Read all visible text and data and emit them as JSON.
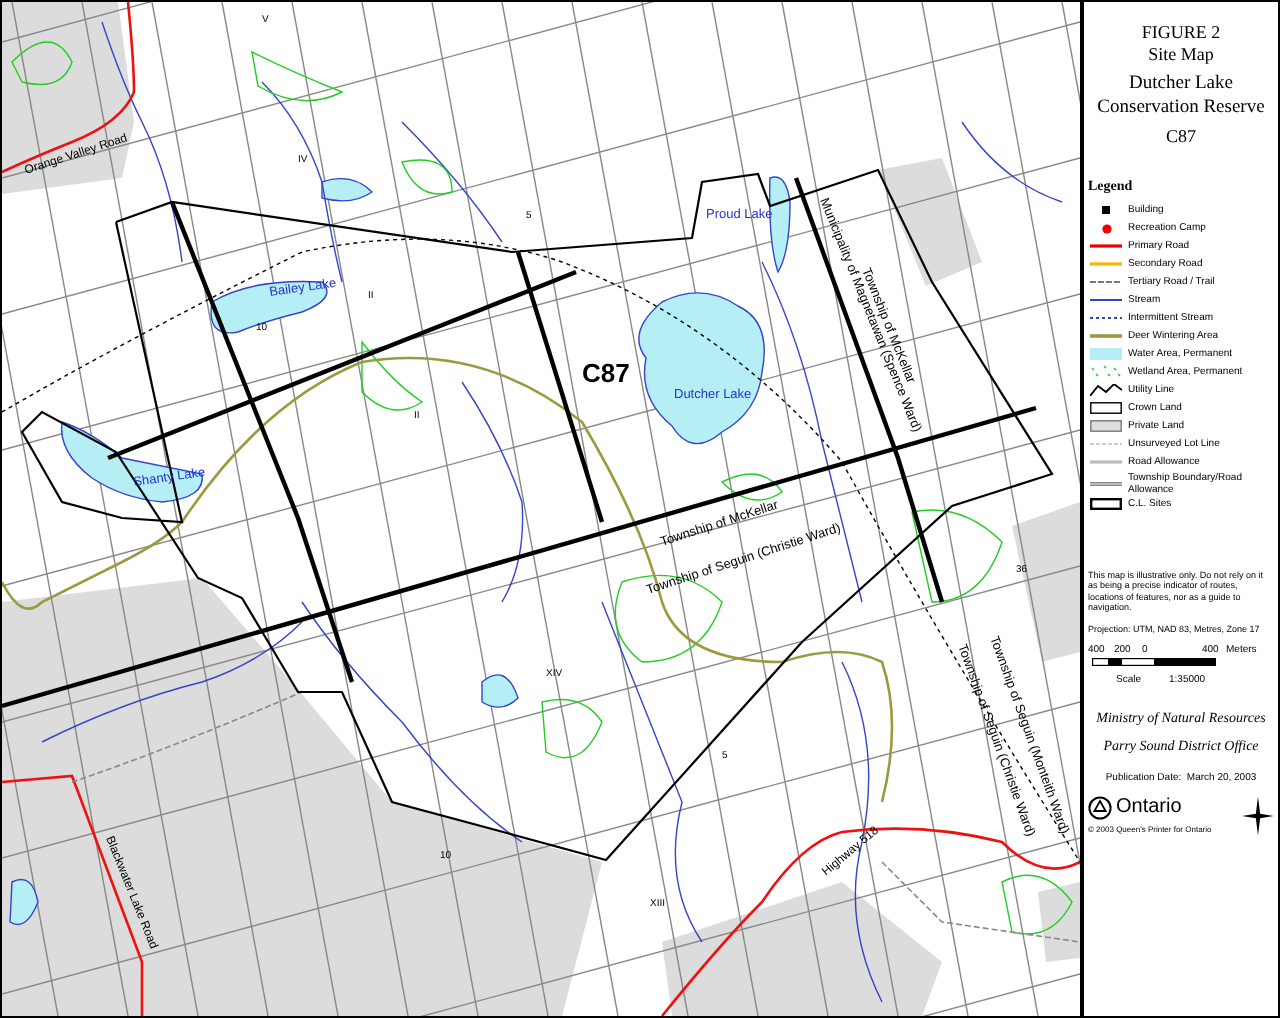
{
  "map": {
    "labels": [
      {
        "text": "V",
        "kind": "lot"
      },
      {
        "text": "IV",
        "kind": "lot"
      },
      {
        "text": "5",
        "kind": "lot"
      },
      {
        "text": "Orange Valley Road",
        "kind": "road"
      },
      {
        "text": "Bailey Lake",
        "kind": "lake"
      },
      {
        "text": "10",
        "kind": "lot"
      },
      {
        "text": "II",
        "kind": "lot"
      },
      {
        "text": "II",
        "kind": "lot"
      },
      {
        "text": "C87",
        "kind": "site"
      },
      {
        "text": "Dutcher Lake",
        "kind": "lake"
      },
      {
        "text": "Proud Lake",
        "kind": "lake"
      },
      {
        "text": "Municipality of Magnetawan (Spence Ward)",
        "kind": "area"
      },
      {
        "text": "Township of McKellar",
        "kind": "area"
      },
      {
        "text": "Shanty Lake",
        "kind": "lake"
      },
      {
        "text": "Township of McKellar",
        "kind": "area"
      },
      {
        "text": "Township of Seguin (Christie Ward)",
        "kind": "area"
      },
      {
        "text": "36",
        "kind": "lot"
      },
      {
        "text": "XIV",
        "kind": "lot"
      },
      {
        "text": "5",
        "kind": "lot"
      },
      {
        "text": "10",
        "kind": "lot"
      },
      {
        "text": "XIII",
        "kind": "lot"
      },
      {
        "text": "Township of Seguin (Christie Ward)",
        "kind": "area"
      },
      {
        "text": "Township of Seguin (Monteith Ward)",
        "kind": "area"
      },
      {
        "text": "Highway 518",
        "kind": "road"
      },
      {
        "text": "Blackwater Lake Road",
        "kind": "road"
      }
    ]
  },
  "title_block": {
    "figure": "FIGURE 2",
    "subtitle": "Site Map",
    "name": "Dutcher Lake Conservation Reserve",
    "code": "C87"
  },
  "legend": {
    "title": "Legend",
    "items": [
      {
        "label": "Building",
        "kind": "building"
      },
      {
        "label": "Recreation Camp",
        "kind": "camp"
      },
      {
        "label": "Primary Road",
        "kind": "primary-road"
      },
      {
        "label": "Secondary Road",
        "kind": "secondary-road"
      },
      {
        "label": "Tertiary Road / Trail",
        "kind": "tertiary-road"
      },
      {
        "label": "Stream",
        "kind": "stream"
      },
      {
        "label": "Intermittent Stream",
        "kind": "intermittent-stream"
      },
      {
        "label": "Deer Wintering Area",
        "kind": "deer-area"
      },
      {
        "label": "Water Area, Permanent",
        "kind": "water"
      },
      {
        "label": "Wetland Area, Permanent",
        "kind": "wetland"
      },
      {
        "label": "Utility Line",
        "kind": "utility"
      },
      {
        "label": "Crown Land",
        "kind": "crown-land"
      },
      {
        "label": "Private Land",
        "kind": "private-land"
      },
      {
        "label": "Unsurveyed Lot Line",
        "kind": "lot-line"
      },
      {
        "label": "Road Allowance",
        "kind": "road-allowance"
      },
      {
        "label": "Township Boundary/Road Allowance",
        "kind": "township-boundary"
      },
      {
        "label": "C.L. Sites",
        "kind": "site"
      }
    ]
  },
  "notes": {
    "disclaimer": "This map is illustrative only. Do not rely on it as being a precise indicator of routes, locations of features, nor as a guide to navigation.",
    "projection": "Projection: UTM, NAD 83, Metres, Zone 17"
  },
  "scale": {
    "ticks": [
      "400",
      "200",
      "0",
      "400"
    ],
    "unit": "Meters",
    "label": "Scale",
    "ratio": "1:35000"
  },
  "credits": {
    "ministry": "Ministry of Natural Resources",
    "office": "Parry Sound District Office",
    "date": "Publication Date:  March 20, 2003",
    "logo": "Ontario",
    "copyright": "© 2003 Queen's Printer for Ontario"
  }
}
